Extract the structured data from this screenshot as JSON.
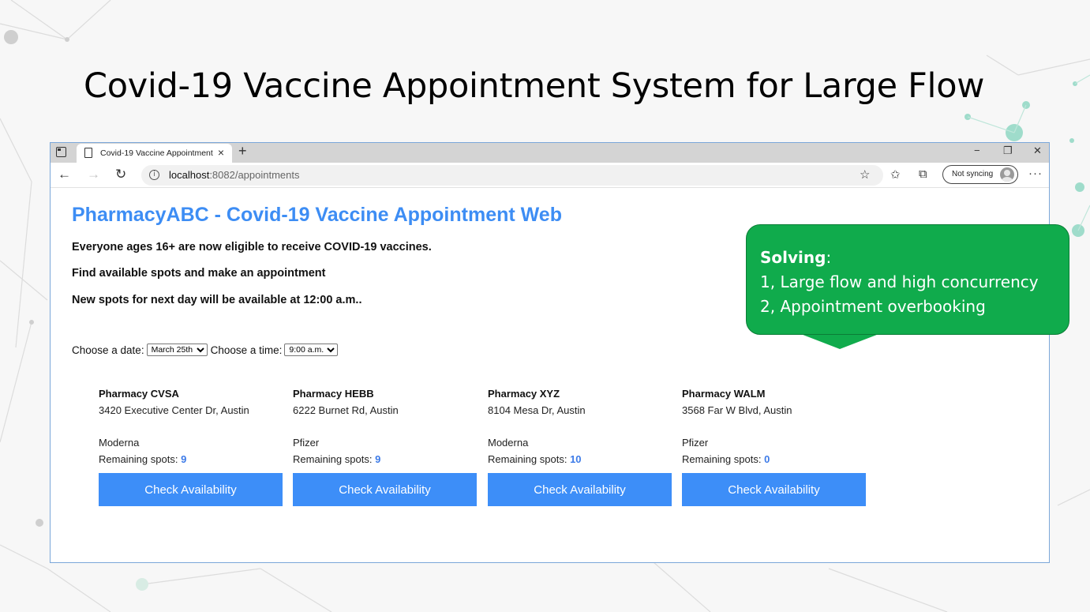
{
  "slide": {
    "title": "Covid-19 Vaccine Appointment System for Large Flow"
  },
  "browser": {
    "tab_title": "Covid-19 Vaccine Appointment",
    "tab_close": "×",
    "new_tab": "+",
    "url_host": "localhost",
    "url_path": ":8082/appointments",
    "sync_label": "Not syncing",
    "more": "···",
    "window_controls": {
      "minimize": "−",
      "restore": "❐",
      "close": "✕"
    },
    "nav": {
      "back": "←",
      "forward": "→",
      "refresh": "↻"
    }
  },
  "page": {
    "site_title": "PharmacyABC - Covid-19 Vaccine Appointment Web",
    "lines": [
      "Everyone ages 16+ are now eligible to receive COVID-19 vaccines.",
      "Find available spots and make an appointment",
      "New spots for next day will be available at 12:00 a.m.."
    ],
    "date_label": "Choose a date:",
    "date_value": "March 25th",
    "time_label": "Choose a time:",
    "time_value": "9:00 a.m.",
    "spots_label": "Remaining spots:",
    "pharmacies": [
      {
        "name": "Pharmacy CVSA",
        "address": "3420 Executive Center Dr, Austin",
        "vaccine": "Moderna",
        "spots": "9",
        "button": "Check Availability"
      },
      {
        "name": "Pharmacy HEBB",
        "address": "6222 Burnet Rd, Austin",
        "vaccine": "Pfizer",
        "spots": "9",
        "button": "Check Availability"
      },
      {
        "name": "Pharmacy XYZ",
        "address": "8104 Mesa Dr, Austin",
        "vaccine": "Moderna",
        "spots": "10",
        "button": "Check Availability"
      },
      {
        "name": "Pharmacy WALM",
        "address": "3568 Far W Blvd, Austin",
        "vaccine": "Pfizer",
        "spots": "0",
        "button": "Check Availability"
      }
    ]
  },
  "callout": {
    "heading": "Solving",
    "colon": ":",
    "items": [
      "1, Large flow and high concurrency",
      "2, Appointment overbooking"
    ]
  },
  "colors": {
    "accent_blue": "#3d8df4",
    "button_blue": "#3d8ef8",
    "callout_green": "#10ab4c"
  }
}
